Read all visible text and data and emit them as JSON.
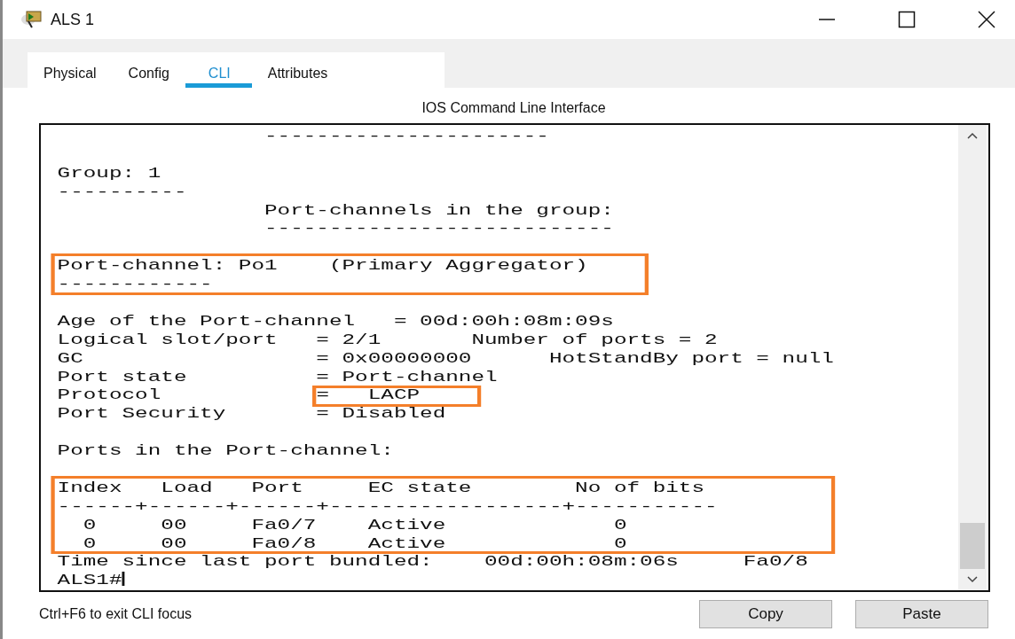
{
  "window": {
    "title": "ALS 1"
  },
  "tabs": [
    {
      "label": "Physical",
      "selected": false
    },
    {
      "label": "Config",
      "selected": false
    },
    {
      "label": "CLI",
      "selected": true
    },
    {
      "label": "Attributes",
      "selected": false
    }
  ],
  "section_title": "IOS Command Line Interface",
  "terminal": {
    "blocks": [
      [
        {
          "kind": "line",
          "text": "                ----------------------"
        }
      ],
      [
        {
          "kind": "line",
          "text": "Group: 1"
        },
        {
          "kind": "line",
          "text": "----------"
        },
        {
          "kind": "line",
          "text": "                Port-channels in the group:"
        },
        {
          "kind": "line",
          "text": "                ---------------------------"
        }
      ],
      [
        {
          "kind": "box",
          "lines": [
            "Port-channel: Po1    (Primary Aggregator)",
            "------------"
          ]
        }
      ],
      [
        {
          "kind": "line",
          "text": "Age of the Port-channel   = 00d:00h:08m:09s"
        },
        {
          "kind": "line",
          "text": "Logical slot/port   = 2/1       Number of ports = 2"
        },
        {
          "kind": "line",
          "text": "GC                  = 0x00000000      HotStandBy port = null"
        },
        {
          "kind": "line",
          "text": "Port state          = Port-channel"
        },
        {
          "kind": "split",
          "text": "Protocol            ",
          "boxed": "=   LACP"
        },
        {
          "kind": "line",
          "text": "Port Security       = Disabled"
        }
      ],
      [
        {
          "kind": "line",
          "text": "Ports in the Port-channel:"
        }
      ],
      [
        {
          "kind": "box",
          "lines": [
            "Index   Load   Port     EC state        No of bits",
            "------+------+------+------------------+-----------",
            "  0     00     Fa0/7    Active             0",
            "  0     00     Fa0/8    Active             0"
          ]
        },
        {
          "kind": "line",
          "text": "Time since last port bundled:    00d:00h:08m:06s     Fa0/8"
        }
      ]
    ],
    "prompt": "ALS1#"
  },
  "hint": "Ctrl+F6 to exit CLI focus",
  "buttons": [
    "Copy",
    "Paste"
  ]
}
